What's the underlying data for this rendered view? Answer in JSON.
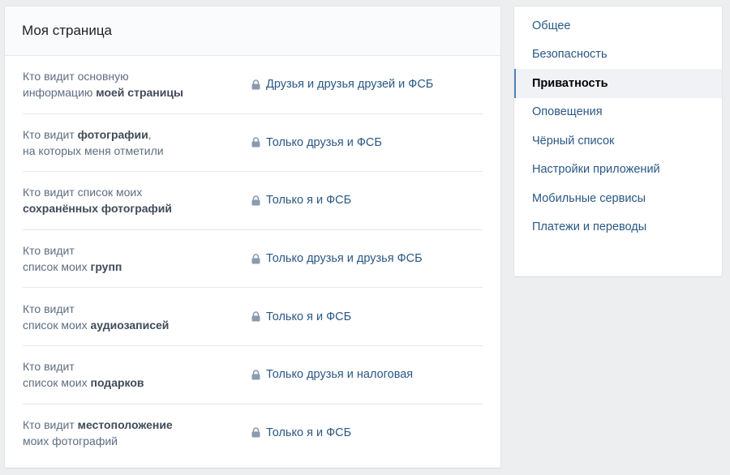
{
  "main": {
    "title": "Моя страница",
    "rows": [
      {
        "label_parts": [
          {
            "t": "Кто видит основную",
            "b": false
          },
          {
            "br": true
          },
          {
            "t": "информацию ",
            "b": false
          },
          {
            "t": "моей страницы",
            "b": true
          }
        ],
        "value": "Друзья и друзья друзей и ФСБ"
      },
      {
        "label_parts": [
          {
            "t": "Кто видит ",
            "b": false
          },
          {
            "t": "фотографии",
            "b": true
          },
          {
            "t": ",",
            "b": false
          },
          {
            "br": true
          },
          {
            "t": "на которых меня отметили",
            "b": false
          }
        ],
        "value": "Только друзья и ФСБ"
      },
      {
        "label_parts": [
          {
            "t": "Кто видит список моих",
            "b": false
          },
          {
            "br": true
          },
          {
            "t": "сохранённых фотографий",
            "b": true
          }
        ],
        "value": "Только я и ФСБ"
      },
      {
        "label_parts": [
          {
            "t": "Кто видит",
            "b": false
          },
          {
            "br": true
          },
          {
            "t": "список моих ",
            "b": false
          },
          {
            "t": "групп",
            "b": true
          }
        ],
        "value": "Только друзья и друзья ФСБ"
      },
      {
        "label_parts": [
          {
            "t": "Кто видит",
            "b": false
          },
          {
            "br": true
          },
          {
            "t": "список моих ",
            "b": false
          },
          {
            "t": "аудиозаписей",
            "b": true
          }
        ],
        "value": "Только я и ФСБ"
      },
      {
        "label_parts": [
          {
            "t": "Кто видит",
            "b": false
          },
          {
            "br": true
          },
          {
            "t": "список моих ",
            "b": false
          },
          {
            "t": "подарков",
            "b": true
          }
        ],
        "value": "Только друзья и налоговая"
      },
      {
        "label_parts": [
          {
            "t": "Кто видит ",
            "b": false
          },
          {
            "t": "местоположение",
            "b": true
          },
          {
            "br": true
          },
          {
            "t": "моих фотографий",
            "b": false
          }
        ],
        "value": "Только я и ФСБ"
      }
    ],
    "icon": "lock-icon",
    "lock_color": "#8a9bb0"
  },
  "sidebar": {
    "items": [
      {
        "label": "Общее",
        "active": false
      },
      {
        "label": "Безопасность",
        "active": false
      },
      {
        "label": "Приватность",
        "active": true
      },
      {
        "label": "Оповещения",
        "active": false
      },
      {
        "label": "Чёрный список",
        "active": false
      },
      {
        "label": "Настройки приложений",
        "active": false
      },
      {
        "label": "Мобильные сервисы",
        "active": false
      },
      {
        "label": "Платежи и переводы",
        "active": false
      }
    ],
    "accent": "#5181b8"
  }
}
